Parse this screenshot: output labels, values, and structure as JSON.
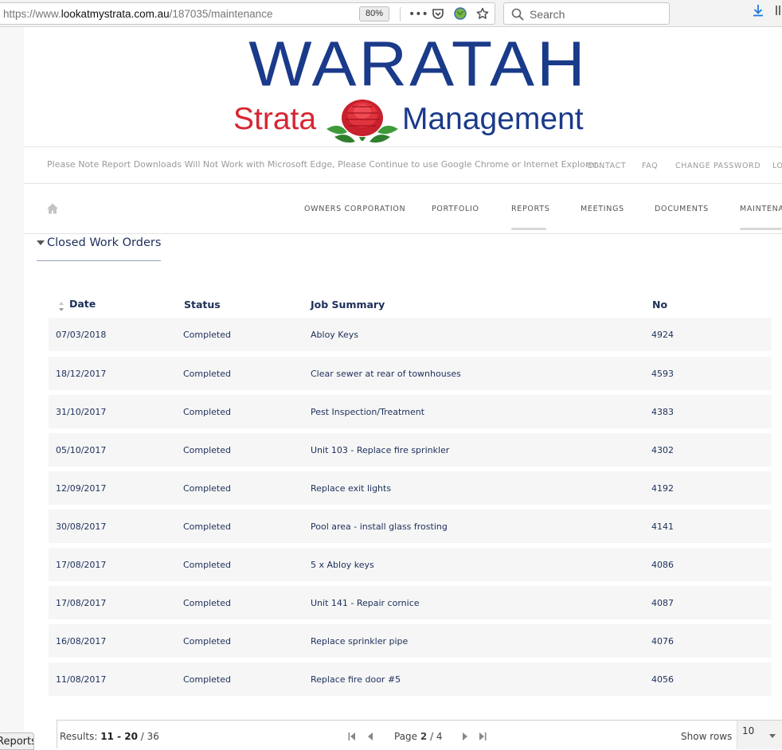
{
  "browser": {
    "url_prefix": "https://www.",
    "url_domain": "lookatmystrata.com.au",
    "url_path": "/187035/maintenance",
    "zoom": "80%",
    "search_placeholder": "Search"
  },
  "logo": {
    "title": "WARATAH",
    "sub_left": "Strata",
    "sub_right": "Management"
  },
  "notice": "Please Note Report Downloads Will Not Work with Microsoft Edge, Please Continue to use Google Chrome or Internet Explorer.",
  "top_links": [
    "CONTACT",
    "FAQ",
    "CHANGE PASSWORD",
    "LO"
  ],
  "nav": [
    "OWNERS CORPORATION",
    "PORTFOLIO",
    "REPORTS",
    "MEETINGS",
    "DOCUMENTS",
    "MAINTENA"
  ],
  "section_title": "Closed Work Orders",
  "table": {
    "headers": [
      "Date",
      "Status",
      "Job Summary",
      "No"
    ],
    "rows": [
      [
        "07/03/2018",
        "Completed",
        "Abloy Keys",
        "4924"
      ],
      [
        "18/12/2017",
        "Completed",
        "Clear sewer at rear of townhouses",
        "4593"
      ],
      [
        "31/10/2017",
        "Completed",
        "Pest Inspection/Treatment",
        "4383"
      ],
      [
        "05/10/2017",
        "Completed",
        "Unit 103 - Replace fire sprinkler",
        "4302"
      ],
      [
        "12/09/2017",
        "Completed",
        "Replace exit lights",
        "4192"
      ],
      [
        "30/08/2017",
        "Completed",
        "Pool area - install glass frosting",
        "4141"
      ],
      [
        "17/08/2017",
        "Completed",
        "5 x Abloy keys",
        "4086"
      ],
      [
        "17/08/2017",
        "Completed",
        "Unit 141 - Repair cornice",
        "4087"
      ],
      [
        "16/08/2017",
        "Completed",
        "Replace sprinkler pipe",
        "4076"
      ],
      [
        "11/08/2017",
        "Completed",
        "Replace fire door #5",
        "4056"
      ]
    ]
  },
  "pager": {
    "results_label": "Results:",
    "results_range": "11 - 20",
    "results_total": "/ 36",
    "page_label": "Page",
    "page_current": "2",
    "page_total": "/ 4",
    "show_rows_label": "Show rows",
    "rows_value": "10"
  },
  "side_tab": "Reports"
}
